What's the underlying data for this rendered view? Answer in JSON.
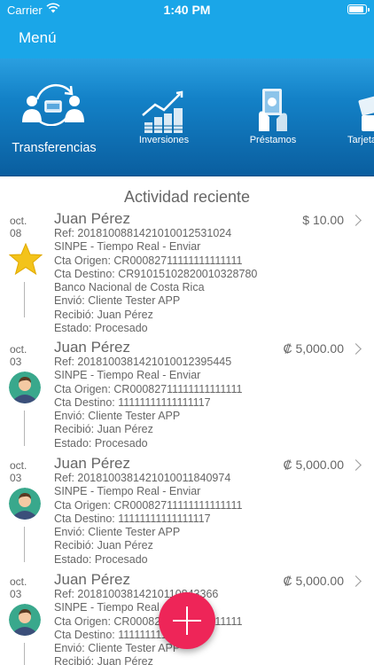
{
  "status_bar": {
    "carrier": "Carrier",
    "time": "1:40 PM"
  },
  "nav": {
    "title": "Menú"
  },
  "tabs": [
    {
      "label": "Transferencias",
      "icon": "transfer-icon",
      "active": true
    },
    {
      "label": "Inversiones",
      "icon": "investments-chart-icon",
      "active": false
    },
    {
      "label": "Préstamos",
      "icon": "loan-hand-money-icon",
      "active": false
    },
    {
      "label": "Tarjeta",
      "icon": "card-icon",
      "active": false
    }
  ],
  "activity": {
    "title": "Actividad reciente",
    "items": [
      {
        "date_month": "oct.",
        "date_day": "08",
        "icon": "star-icon",
        "name": "Juan Pérez",
        "amount": "$ 10.00",
        "lines": [
          "Ref:  2018100881421010012531024",
          "SINPE -  Tiempo Real -  Enviar",
          "Cta Origen:  CR00082711111111111111",
          "Cta Destino:  CR91015102820010328780",
          "Banco Nacional de Costa Rica",
          "Envió:  Cliente Tester APP",
          "Recibió:  Juan Pérez",
          "Estado:  Procesado"
        ]
      },
      {
        "date_month": "oct.",
        "date_day": "03",
        "icon": "avatar-icon",
        "name": "Juan Pérez",
        "amount": "₡ 5,000.00",
        "lines": [
          "Ref:  2018100381421010012395445",
          "SINPE -  Tiempo Real -  Enviar",
          "Cta Origen:  CR00082711111111111111",
          "Cta Destino:  11111111111111117",
          "Envió:  Cliente Tester APP",
          "Recibió:  Juan Pérez",
          "Estado:  Procesado"
        ]
      },
      {
        "date_month": "oct.",
        "date_day": "03",
        "icon": "avatar-icon",
        "name": "Juan Pérez",
        "amount": "₡ 5,000.00",
        "lines": [
          "Ref:  2018100381421010011840974",
          "SINPE -  Tiempo Real -  Enviar",
          "Cta Origen:  CR00082711111111111111",
          "Cta Destino:  11111111111111117",
          "Envió:  Cliente Tester APP",
          "Recibió:  Juan Pérez",
          "Estado:  Procesado"
        ]
      },
      {
        "date_month": "oct.",
        "date_day": "03",
        "icon": "avatar-icon",
        "name": "Juan Pérez",
        "amount": "₡ 5,000.00",
        "lines": [
          "Ref:  20181003814210110843366",
          "SINPE -  Tiempo Real -  Enviar",
          "Cta Origen:  CR00082711111111111111",
          "Cta Destino:  11111111111111117",
          "Envió:  Cliente Tester APP",
          "Recibió:  Juan Pérez"
        ]
      }
    ]
  },
  "fab": {
    "icon": "plus-icon"
  },
  "colors": {
    "nav_bg": "#1aa6e8",
    "fab": "#ee2558",
    "text": "#666666"
  }
}
